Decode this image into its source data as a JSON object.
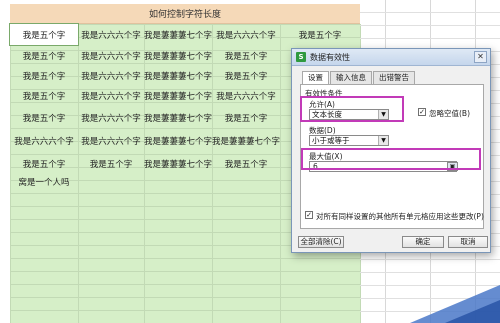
{
  "sheet": {
    "title": "如何控制字符长度",
    "rows": [
      [
        "我是五个字",
        "我是六六六个字",
        "我是萋萋萋七个字",
        "我是六六六个字",
        "我是五个字"
      ],
      [
        "我是五个字",
        "我是六六六个字",
        "我是萋萋萋七个字",
        "我是五个字",
        ""
      ],
      [
        "我是五个字",
        "我是六六六个字",
        "我是萋萋萋七个字",
        "我是五个字",
        ""
      ],
      [
        "我是五个字",
        "我是六六六个字",
        "我是萋萋萋七个字",
        "我是六六六个字",
        ""
      ],
      [
        "我是五个字",
        "我是六六六个字",
        "我是萋萋萋七个字",
        "我是五个字",
        ""
      ],
      [
        "我是六六六个字",
        "我是六六六个字",
        "我是萋萋萋七个字",
        "我是萋萋萋七个字",
        ""
      ],
      [
        "我是五个字",
        "我是五个字",
        "我是萋萋萋七个字",
        "我是五个字",
        ""
      ],
      [
        "窝是一个人吗",
        "",
        "",
        "",
        ""
      ]
    ]
  },
  "dialog": {
    "icon_letter": "S",
    "title": "数据有效性",
    "close_glyph": "✕",
    "tabs": [
      "设置",
      "输入信息",
      "出错警告"
    ],
    "section_label": "有效性条件",
    "allow_label": "允许(A)",
    "allow_value": "文本长度",
    "ignore_blank_label": "忽略空值(B)",
    "ignore_blank_checked": "✓",
    "data_label": "数据(D)",
    "data_value": "小于或等于",
    "max_label": "最大值(X)",
    "max_value": "6",
    "apply_all_label": "对所有同样设置的其他所有单元格应用这些更改(P)",
    "apply_all_checked": "✓",
    "clear_button": "全部清除(C)",
    "ok_button": "确定",
    "cancel_button": "取消",
    "highlight_color": "#c23ab8"
  }
}
